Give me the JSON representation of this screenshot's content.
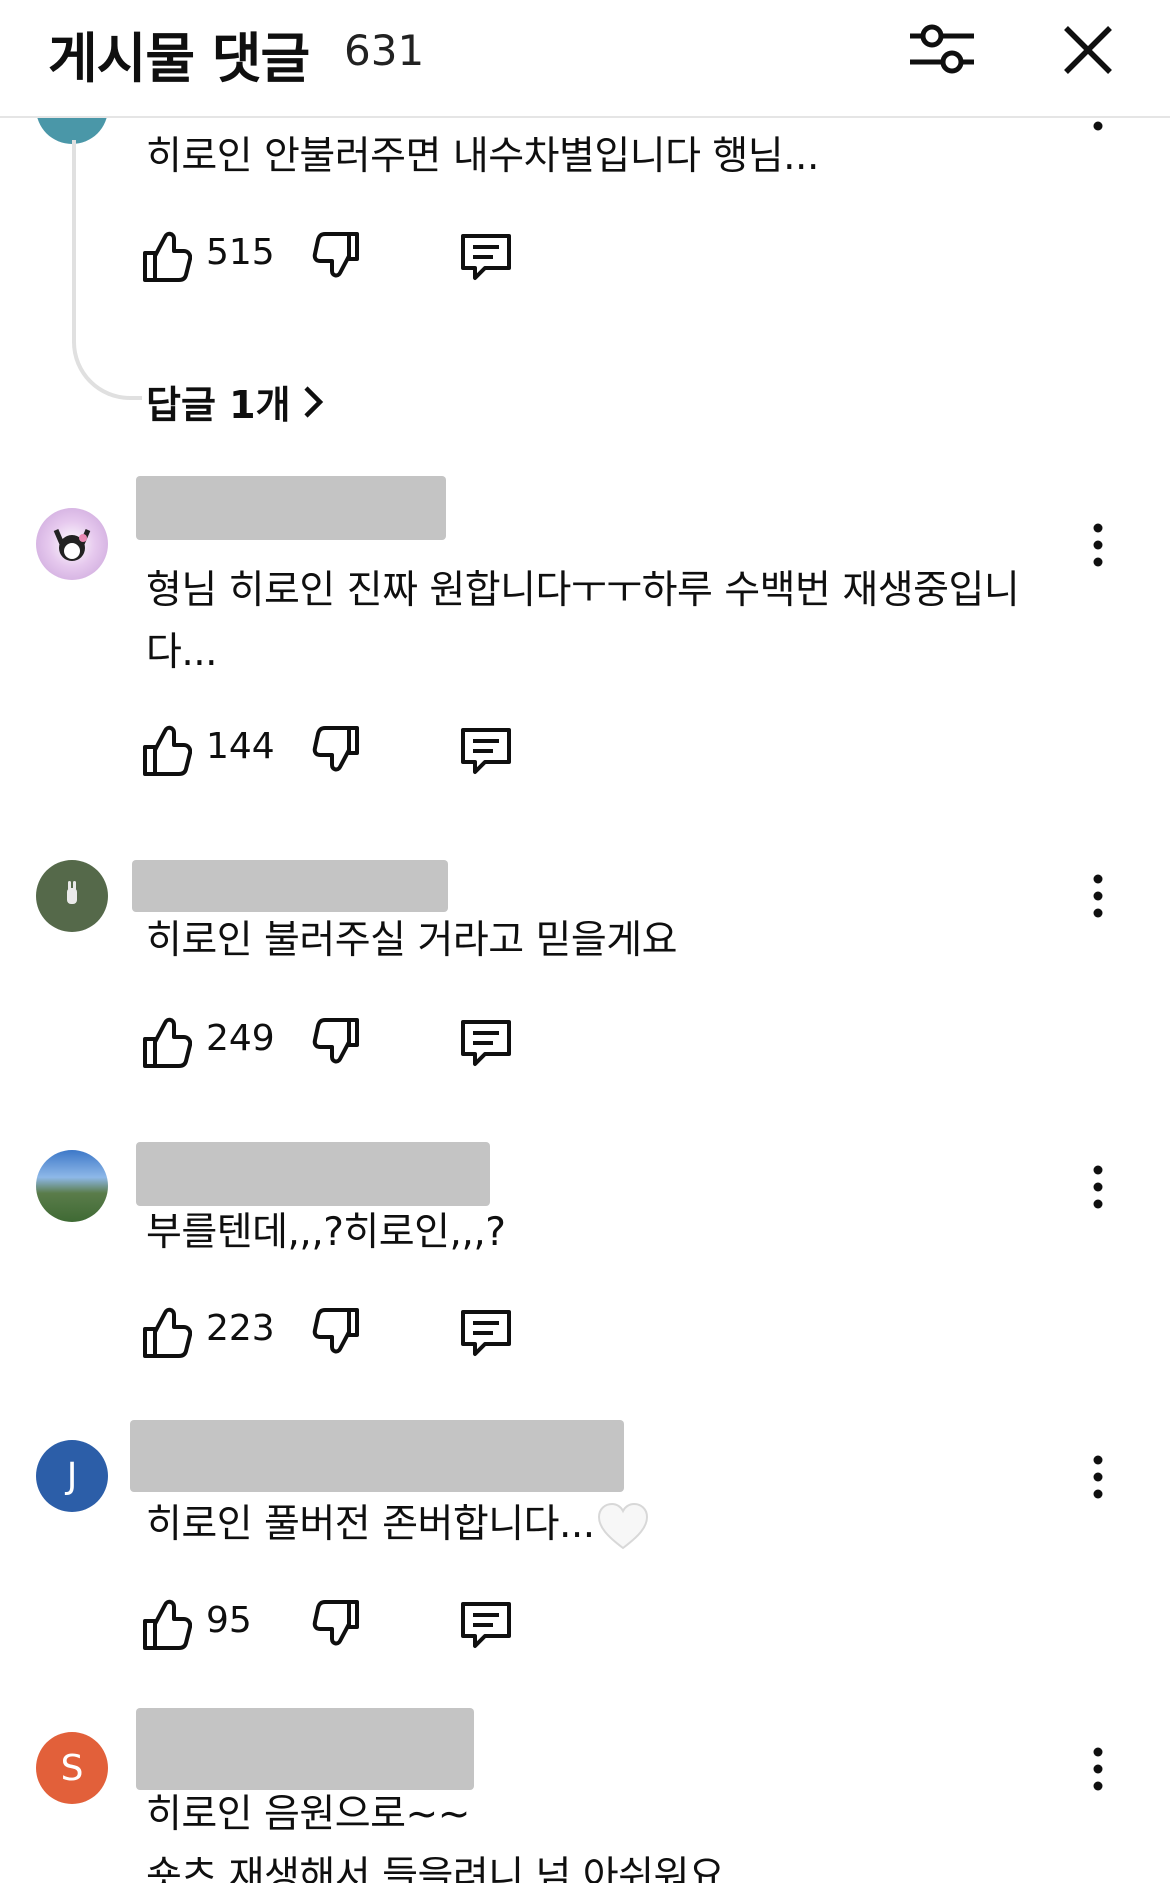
{
  "header": {
    "title": "게시물 댓글",
    "count": "631"
  },
  "replies_link": "답글 1개",
  "comments": [
    {
      "text": "히로인 안불러주면 내수차별입니다 행님...",
      "likes": "515"
    },
    {
      "text": "형님 히로인 진짜 원합니다ㅜㅜ하루 수백번 재생중입니다...",
      "likes": "144"
    },
    {
      "text": "히로인 불러주실 거라고 믿을게요",
      "likes": "249"
    },
    {
      "text": "부를텐데,,,?히로인,,,?",
      "likes": "223"
    },
    {
      "text": "히로인 풀버전 존버합니다...",
      "likes": "95",
      "avatar_letter": "J",
      "avatar_color": "#2c5ea8",
      "emoji": "white-heart"
    },
    {
      "text_line1": "히로인 음원으로~~",
      "text_line2": "숏츠 재생해서 들을려니 넘 아쉬워요",
      "avatar_letter": "S",
      "avatar_color": "#e2603a"
    }
  ],
  "icons": [
    "filter-icon",
    "close-icon",
    "thumbs-up-icon",
    "thumbs-down-icon",
    "reply-icon",
    "more-vert-icon",
    "chevron-right-icon"
  ]
}
